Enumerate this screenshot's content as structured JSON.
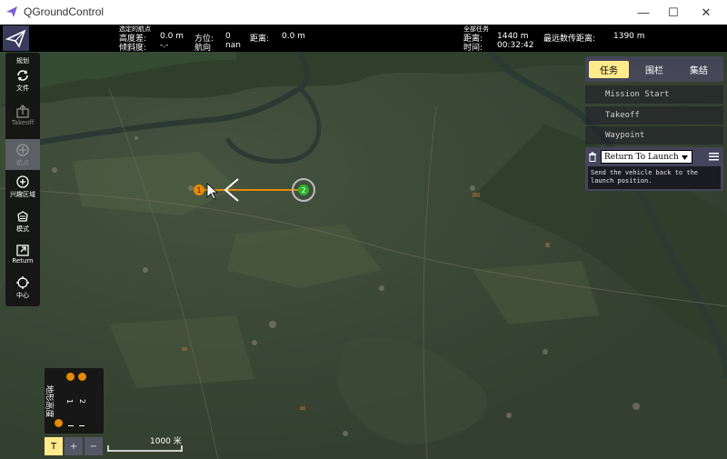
{
  "window": {
    "title": "QGroundControl",
    "controls": {
      "minimize": "—",
      "maximize": "☐",
      "close": "✕"
    }
  },
  "toolbar": {
    "selected_waypoint": {
      "caption": "选定的航点",
      "alt_diff_label": "高度差:",
      "alt_diff_value": "0.0 m",
      "azimuth_label": "方位:",
      "azimuth_value": "0",
      "distance_label": "距离:",
      "distance_value": "0.0 m",
      "gradient_label": "倾斜度:",
      "gradient_value": "-.-",
      "heading_label": "航向",
      "heading_value": "nan"
    },
    "total_mission": {
      "caption": "全部任务",
      "distance_label": "距离:",
      "distance_value": "1440 m",
      "time_label": "时间:",
      "time_value": "00:32:42",
      "max_telem_label": "最远数传距离:",
      "max_telem_value": "1390 m"
    }
  },
  "plan_tools": {
    "header": "规划",
    "items": [
      {
        "label": "文件",
        "icon": "sync-icon",
        "enabled": true
      },
      {
        "label": "Takeoff",
        "icon": "takeoff-icon",
        "enabled": false
      },
      {
        "label": "航点",
        "icon": "add-waypoint-icon",
        "enabled": false,
        "selected": true
      },
      {
        "label": "兴趣区域",
        "icon": "roi-icon",
        "enabled": true
      },
      {
        "label": "模式",
        "icon": "pattern-icon",
        "enabled": true
      },
      {
        "label": "Return",
        "icon": "return-icon",
        "enabled": true
      },
      {
        "label": "中心",
        "icon": "center-icon",
        "enabled": true
      }
    ]
  },
  "mission_panel": {
    "tabs": [
      {
        "label": "任务",
        "active": true
      },
      {
        "label": "围栏",
        "active": false
      },
      {
        "label": "集结",
        "active": false
      }
    ],
    "items": [
      "Mission Start",
      "Takeoff",
      "Waypoint"
    ],
    "editor": {
      "command": "Return To Launch",
      "description": "Send the vehicle back to the launch position."
    }
  },
  "map": {
    "markers": [
      {
        "label": "1",
        "kind": "takeoff"
      },
      {
        "label": "2",
        "kind": "waypoint-current"
      }
    ],
    "path_color": "#e68a00",
    "scale_label": "1000 米"
  },
  "terrain_widget": {
    "title": "地形高度",
    "markers": [
      "1",
      "2"
    ]
  },
  "zoom": {
    "terrain_toggle": "T",
    "zoom_in": "+",
    "zoom_out": "−"
  },
  "colors": {
    "accent": "#ffeb8c",
    "toolbar": "#000000",
    "panel": "#46465a"
  }
}
